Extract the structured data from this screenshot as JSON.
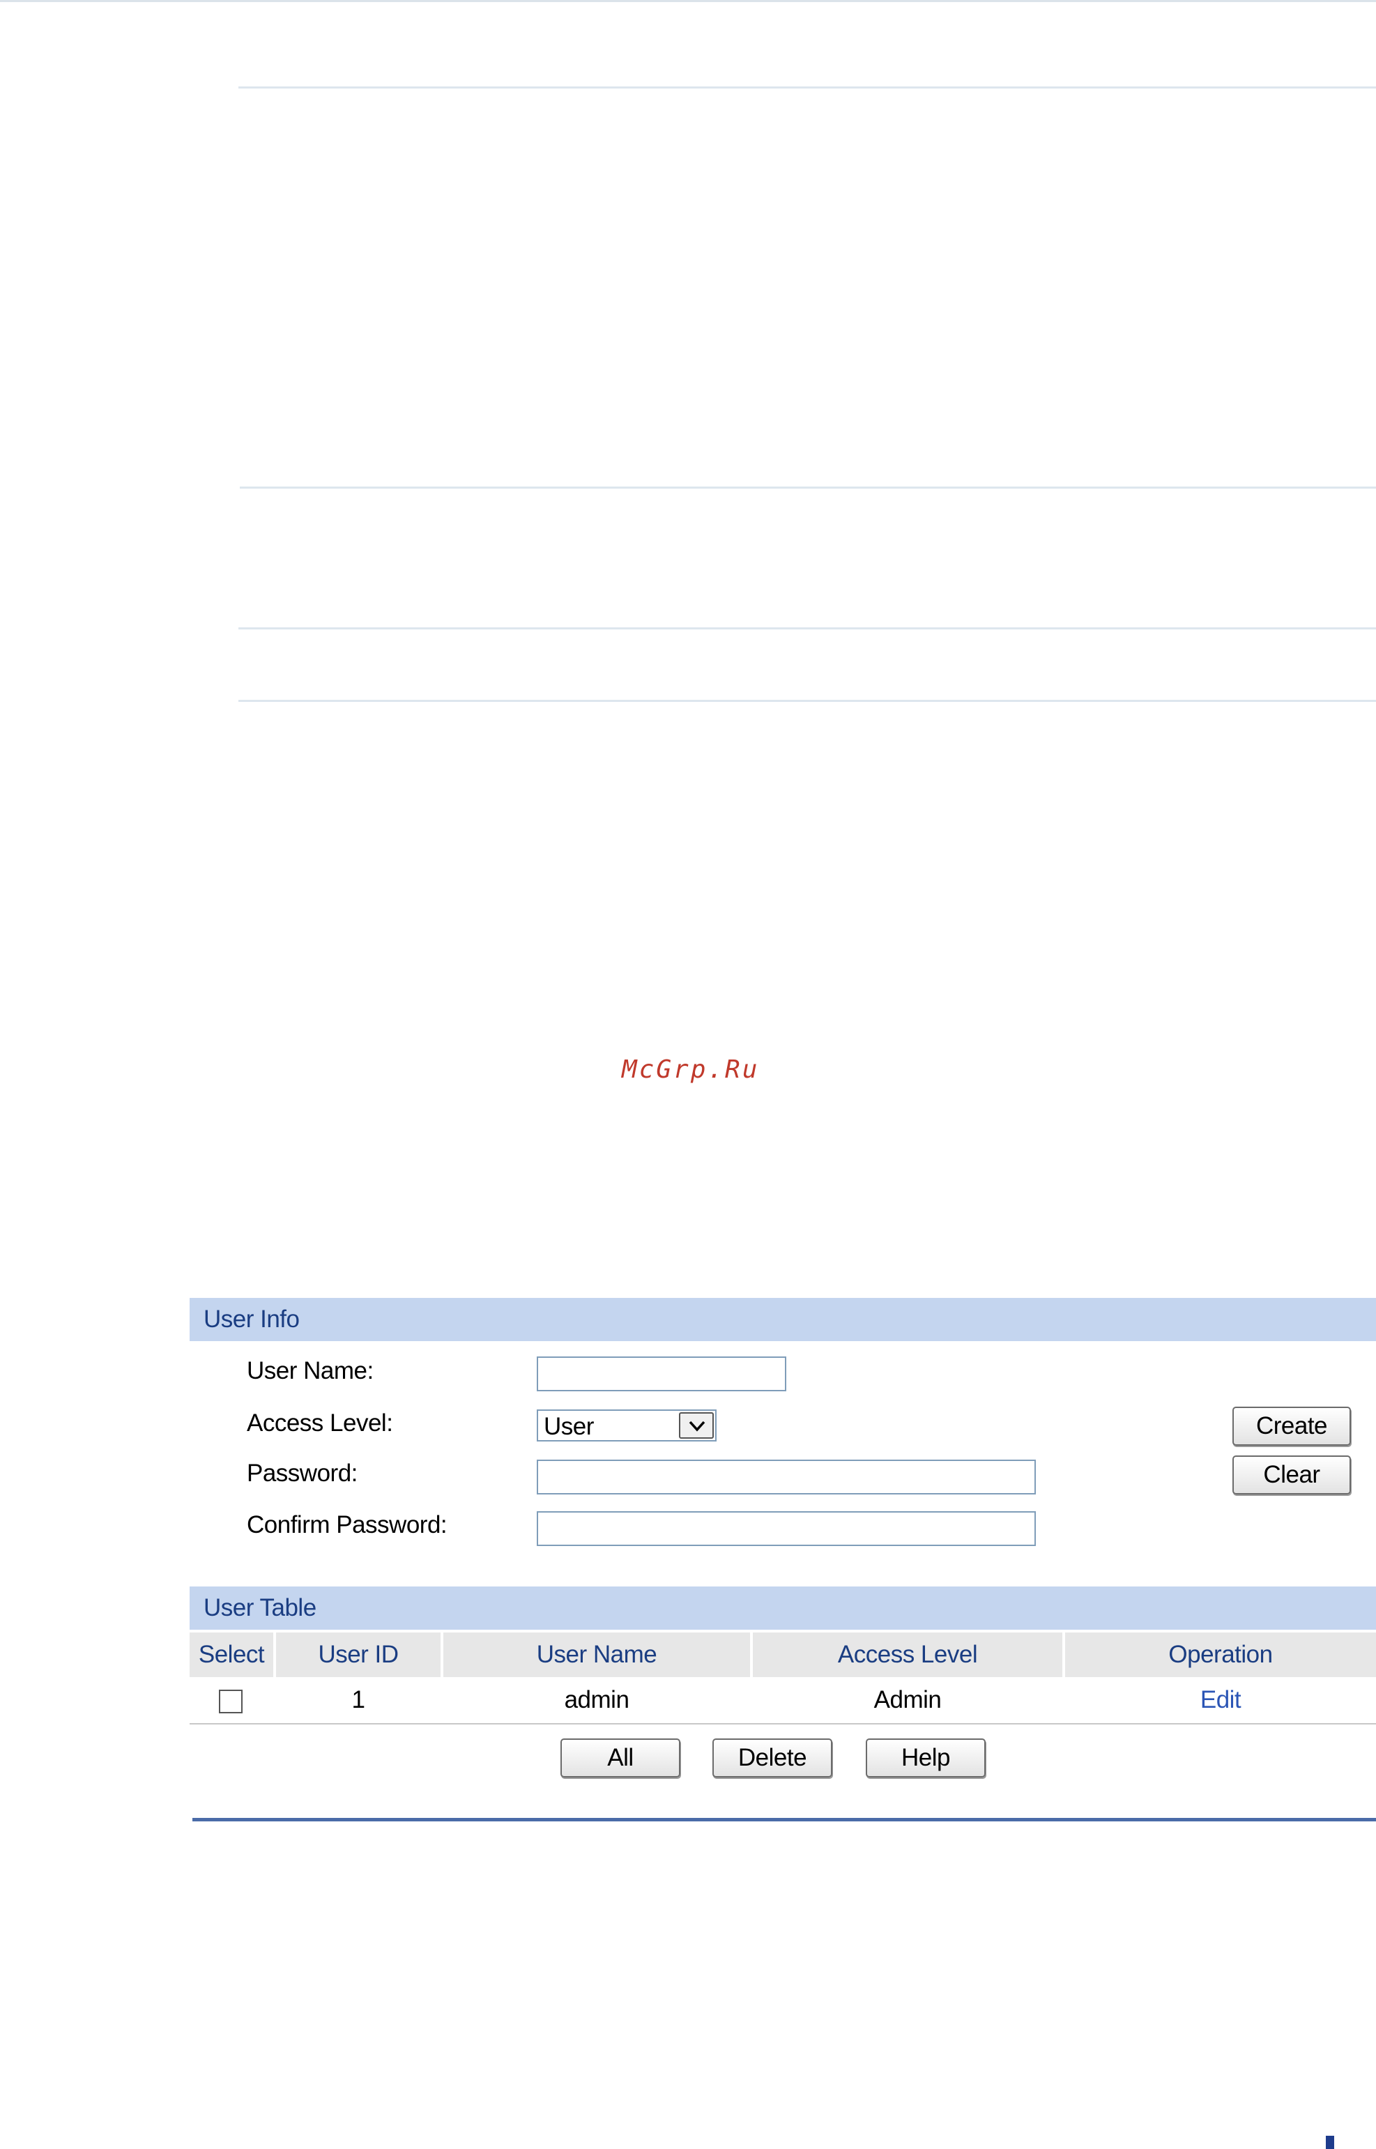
{
  "watermark": "McGrp.Ru",
  "user_info": {
    "title": "User Info",
    "user_name_label": "User Name:",
    "user_name_value": "",
    "access_level_label": "Access Level:",
    "access_level_value": "User",
    "password_label": "Password:",
    "password_value": "",
    "confirm_password_label": "Confirm Password:",
    "confirm_password_value": "",
    "create_button": "Create",
    "clear_button": "Clear"
  },
  "user_table": {
    "title": "User Table",
    "columns": [
      "Select",
      "User ID",
      "User Name",
      "Access Level",
      "Operation"
    ],
    "rows": [
      {
        "selected": false,
        "user_id": "1",
        "user_name": "admin",
        "access_level": "Admin",
        "operation": "Edit"
      }
    ],
    "buttons": {
      "all": "All",
      "delete": "Delete",
      "help": "Help"
    }
  },
  "colors": {
    "section_bar": "#c4d5ef",
    "section_text": "#1a3d82",
    "header_bg": "#e7e7e7",
    "link": "#2b55b5",
    "bottom_rule": "#4a6ba8"
  }
}
